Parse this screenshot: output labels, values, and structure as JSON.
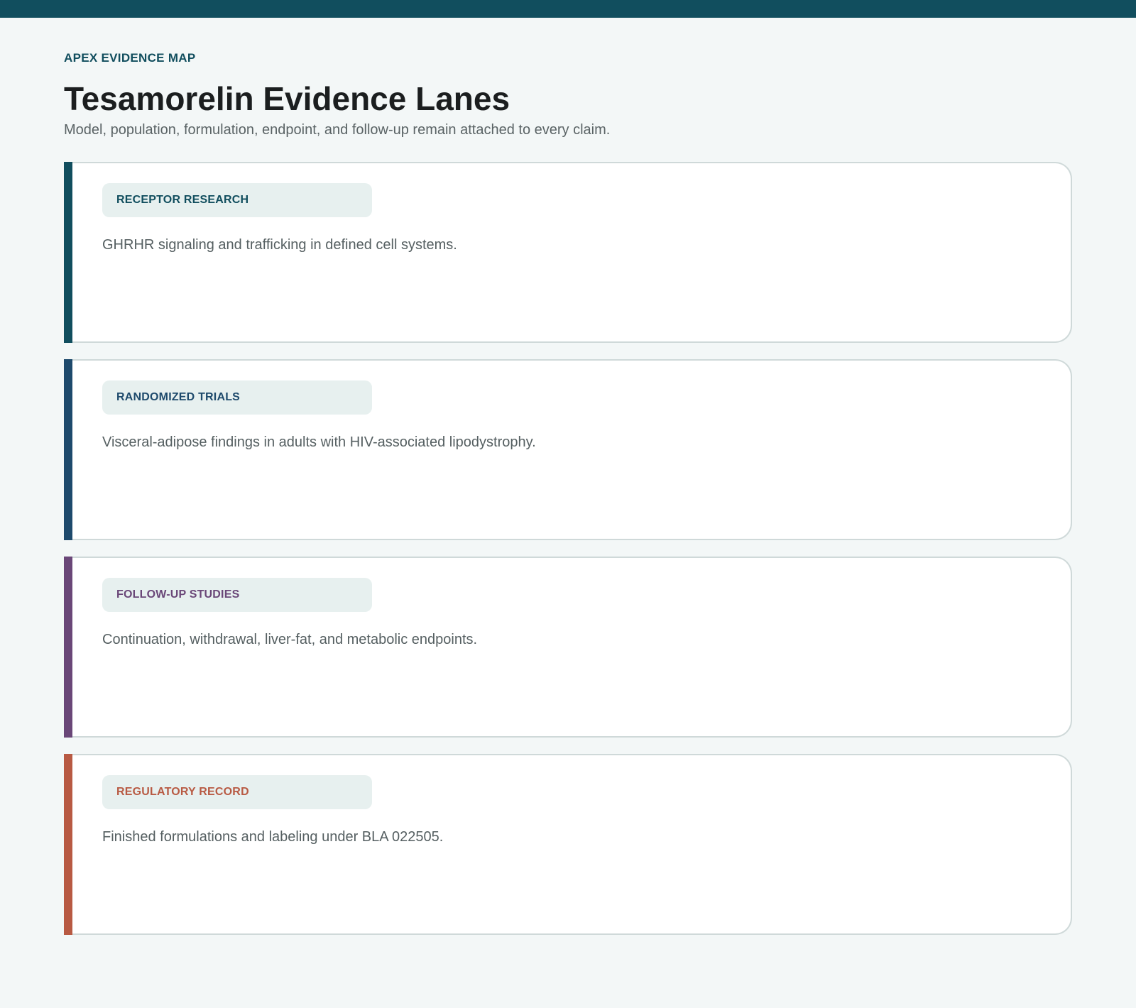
{
  "header": {
    "eyebrow": "APEX EVIDENCE MAP",
    "title": "Tesamorelin Evidence Lanes",
    "subtitle": "Model, population, formulation, endpoint, and follow-up remain attached to every claim."
  },
  "colors": {
    "top_bar": "#114e5e",
    "background": "#f3f7f7"
  },
  "lanes": [
    {
      "label": "RECEPTOR RESEARCH",
      "description": "GHRHR signaling and trafficking in defined cell systems.",
      "accent": "#114e5e"
    },
    {
      "label": "RANDOMIZED TRIALS",
      "description": "Visceral-adipose findings in adults with HIV-associated lipodystrophy.",
      "accent": "#1e4a6c"
    },
    {
      "label": "FOLLOW-UP STUDIES",
      "description": "Continuation, withdrawal, liver-fat, and metabolic endpoints.",
      "accent": "#6a4778"
    },
    {
      "label": "REGULATORY RECORD",
      "description": "Finished formulations and labeling under BLA 022505.",
      "accent": "#b85a43"
    }
  ]
}
